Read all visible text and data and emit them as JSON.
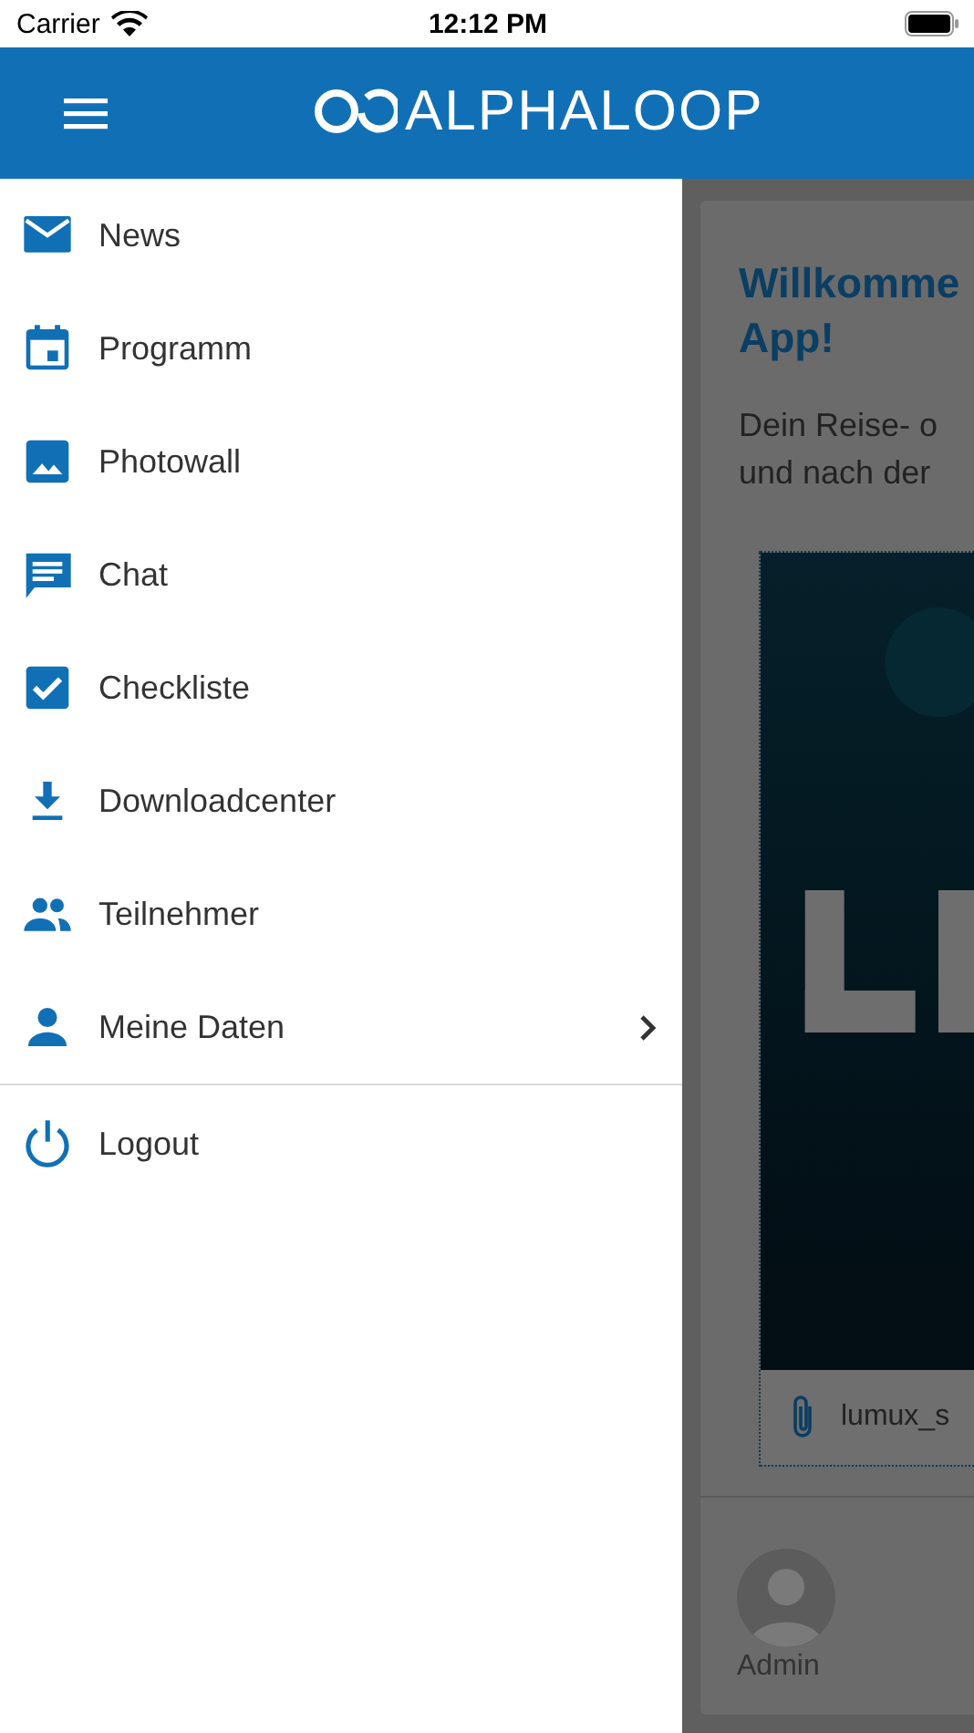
{
  "status_bar": {
    "carrier": "Carrier",
    "time": "12:12 PM"
  },
  "header": {
    "logo": "ALPHALOOP"
  },
  "drawer": {
    "items": [
      {
        "label": "News",
        "has_submenu": false
      },
      {
        "label": "Programm",
        "has_submenu": false
      },
      {
        "label": "Photowall",
        "has_submenu": false
      },
      {
        "label": "Chat",
        "has_submenu": false
      },
      {
        "label": "Checkliste",
        "has_submenu": false
      },
      {
        "label": "Downloadcenter",
        "has_submenu": false
      },
      {
        "label": "Teilnehmer",
        "has_submenu": false
      },
      {
        "label": "Meine Daten",
        "has_submenu": true
      }
    ],
    "footer_items": [
      {
        "label": "Logout"
      }
    ]
  },
  "background": {
    "heading": [
      "Willkomme",
      "App!"
    ],
    "text": [
      "Dein Reise- o",
      "und nach der"
    ],
    "attachment": "lumux_s",
    "author": "Admin"
  }
}
